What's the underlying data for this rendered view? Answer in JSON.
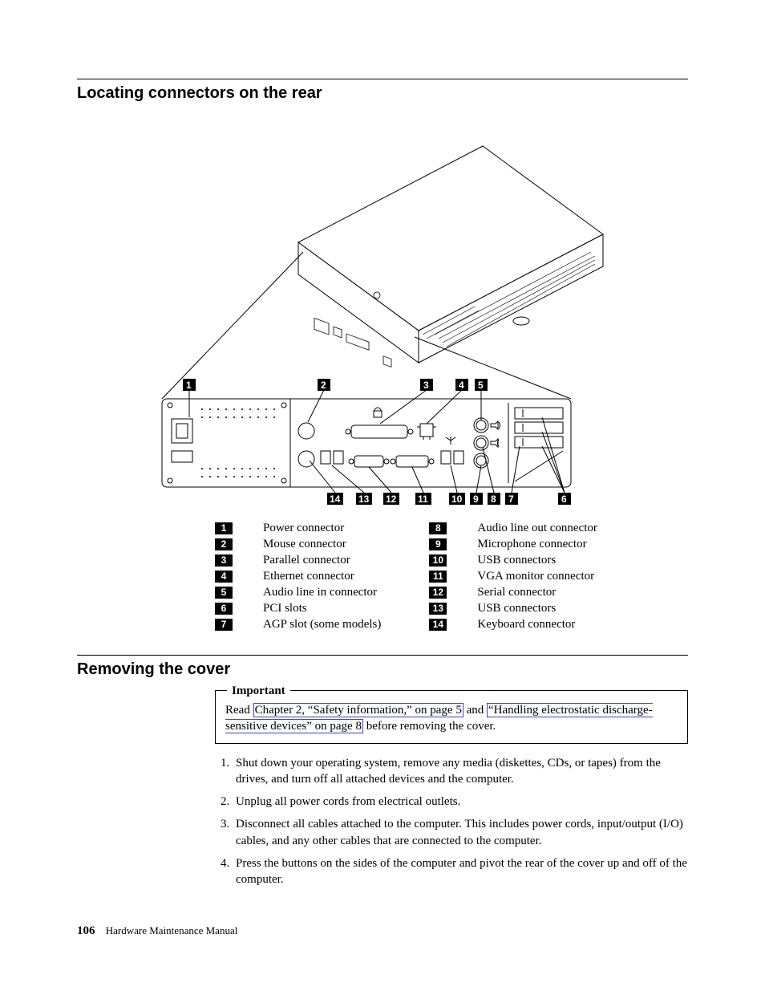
{
  "section1_title": "Locating connectors on the rear",
  "section2_title": "Removing the cover",
  "callouts_top": [
    "1",
    "2",
    "3",
    "4",
    "5"
  ],
  "callouts_bottom": [
    "14",
    "13",
    "12",
    "11",
    "10",
    "9",
    "8",
    "7",
    "6"
  ],
  "legend_left": [
    {
      "n": "1",
      "label": "Power connector"
    },
    {
      "n": "2",
      "label": "Mouse connector"
    },
    {
      "n": "3",
      "label": "Parallel connector"
    },
    {
      "n": "4",
      "label": "Ethernet connector"
    },
    {
      "n": "5",
      "label": "Audio line in connector"
    },
    {
      "n": "6",
      "label": "PCI slots"
    },
    {
      "n": "7",
      "label": "AGP slot (some models)"
    }
  ],
  "legend_right": [
    {
      "n": "8",
      "label": "Audio line out connector"
    },
    {
      "n": "9",
      "label": "Microphone connector"
    },
    {
      "n": "10",
      "label": "USB connectors"
    },
    {
      "n": "11",
      "label": "VGA monitor connector"
    },
    {
      "n": "12",
      "label": "Serial connector"
    },
    {
      "n": "13",
      "label": "USB connectors"
    },
    {
      "n": "14",
      "label": "Keyboard connector"
    }
  ],
  "important": {
    "title": "Important",
    "pre": "Read ",
    "link1": "Chapter 2, “Safety information,” on page 5",
    "mid": " and ",
    "link2": "“Handling electrostatic discharge-sensitive devices” on page 8",
    "post": " before removing the cover."
  },
  "steps": [
    "Shut down your operating system, remove any media (diskettes, CDs, or tapes) from the drives, and turn off all attached devices and the computer.",
    "Unplug all power cords from electrical outlets.",
    "Disconnect all cables attached to the computer. This includes power cords, input/output (I/O) cables, and any other cables that are connected to the computer.",
    "Press the buttons on the sides of the computer and pivot the rear of the cover up and off of the computer."
  ],
  "footer_page": "106",
  "footer_text": "Hardware Maintenance Manual"
}
